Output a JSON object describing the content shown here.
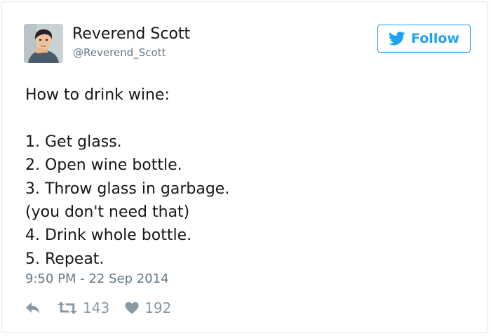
{
  "user": {
    "display_name": "Reverend Scott",
    "handle": "@Reverend_Scott",
    "avatar_icon": "cartoon-portrait"
  },
  "follow": {
    "label": "Follow",
    "icon": "twitter-bird-icon",
    "color": "#1da1f2"
  },
  "tweet": {
    "lines": [
      "How to drink wine:",
      "",
      "1. Get glass.",
      "2. Open wine bottle.",
      "3. Throw glass in garbage.",
      "(you don't need that)",
      "4. Drink whole bottle.",
      "5. Repeat."
    ],
    "timestamp": "9:50 PM - 22 Sep 2014"
  },
  "actions": {
    "reply_icon": "reply-icon",
    "retweet_icon": "retweet-icon",
    "retweet_count": "143",
    "like_icon": "heart-icon",
    "like_count": "192"
  },
  "colors": {
    "text": "#14171a",
    "secondary": "#657786",
    "action": "#8899a6",
    "border": "#e1e8ed"
  }
}
